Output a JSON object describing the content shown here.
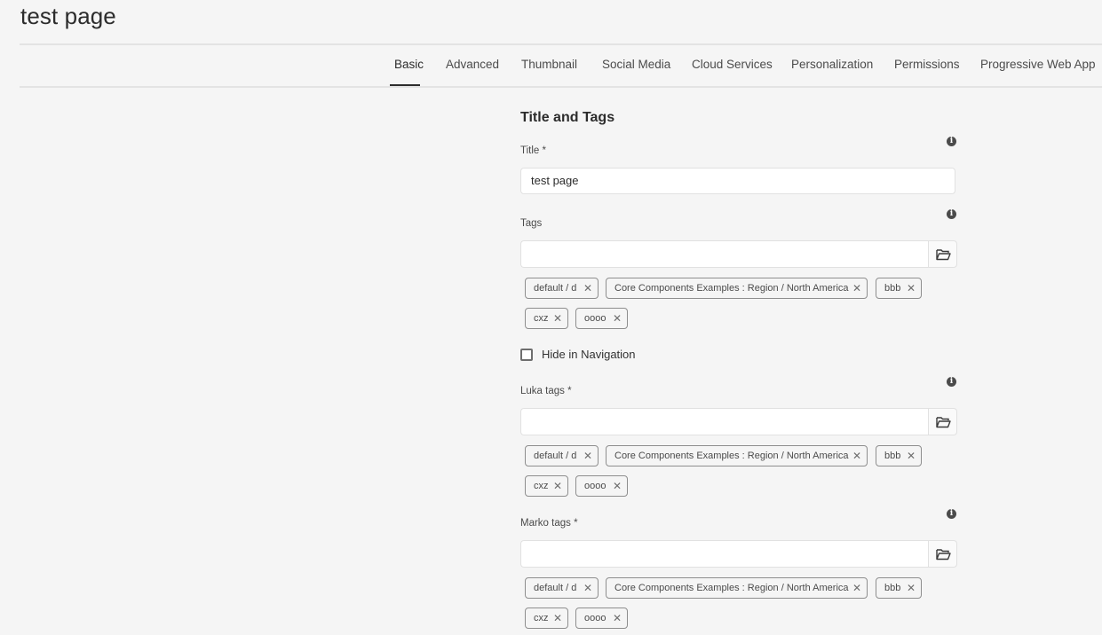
{
  "page": {
    "title": "test page"
  },
  "tabs": [
    {
      "label": "Basic",
      "active": true
    },
    {
      "label": "Advanced",
      "active": false
    },
    {
      "label": "Thumbnail",
      "active": false
    },
    {
      "label": "Social Media",
      "active": false
    },
    {
      "label": "Cloud Services",
      "active": false
    },
    {
      "label": "Personalization",
      "active": false
    },
    {
      "label": "Permissions",
      "active": false
    },
    {
      "label": "Progressive Web App",
      "active": false
    }
  ],
  "form": {
    "section_heading": "Title and Tags",
    "title_field": {
      "label": "Title *",
      "value": "test page"
    },
    "tags_field": {
      "label": "Tags",
      "value": "",
      "chips": [
        "default / d",
        "Core Components Examples : Region / North America",
        "bbb",
        "cxz",
        "oooo"
      ]
    },
    "hide_in_navigation": {
      "label": "Hide in Navigation",
      "checked": false
    },
    "luka_tags_field": {
      "label": "Luka tags *",
      "value": "",
      "chips": [
        "default / d",
        "Core Components Examples : Region / North America",
        "bbb",
        "cxz",
        "oooo"
      ]
    },
    "marko_tags_field": {
      "label": "Marko tags *",
      "value": "",
      "chips": [
        "default / d",
        "Core Components Examples : Region / North America",
        "bbb",
        "cxz",
        "oooo"
      ]
    }
  },
  "icons": {
    "info": "info-icon",
    "folder": "folder-icon",
    "chip_remove": "close-icon",
    "info_glyph": "i",
    "remove_glyph": "✕"
  },
  "colors": {
    "background": "#f5f5f5",
    "input_background": "#ffffff",
    "border": "#e1e1e1",
    "chip_border": "#8e8e8e",
    "text": "#323232"
  }
}
